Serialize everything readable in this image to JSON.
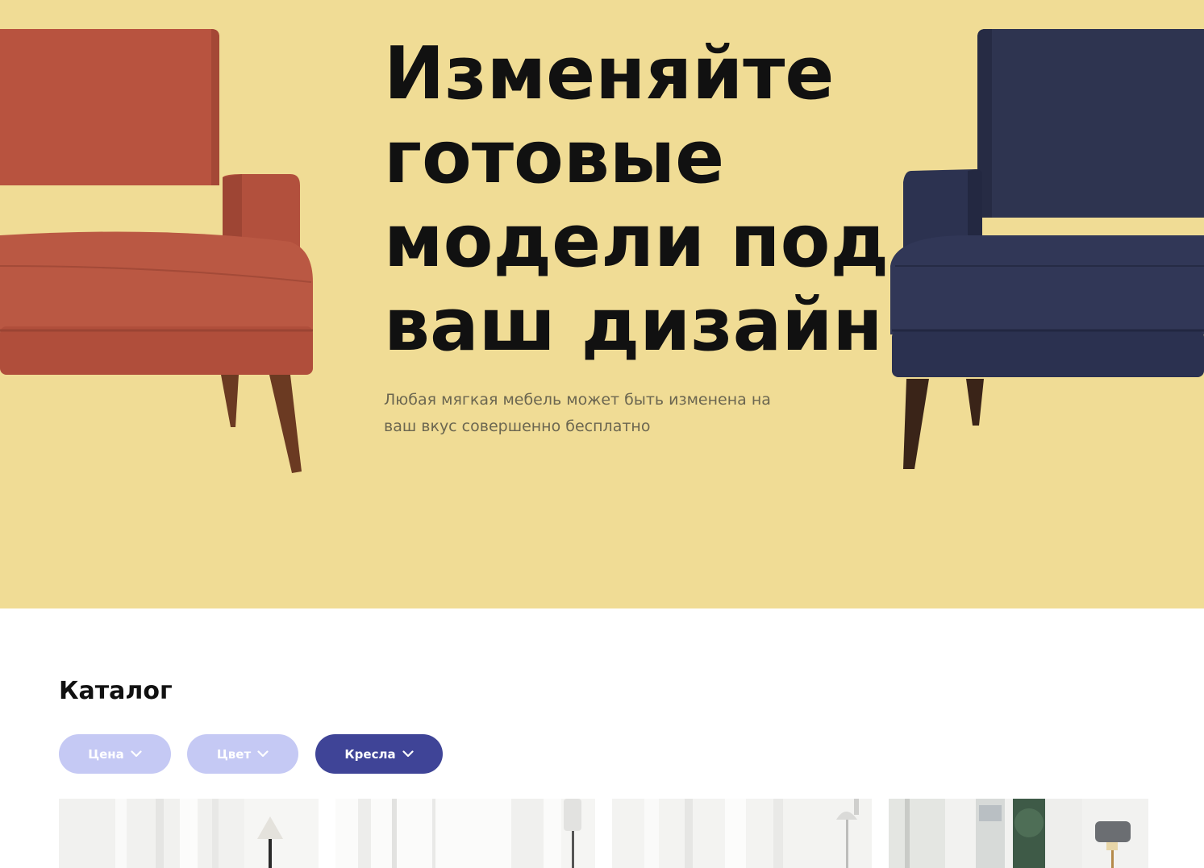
{
  "hero": {
    "title_lines": [
      "Изменяйте",
      "готовые",
      "модели под",
      "ваш дизайн"
    ],
    "subtitle_lines": [
      "Любая мягкая мебель может быть изменена на",
      "ваш вкус совершенно бесплатно"
    ],
    "background_color": "#F0DC95",
    "left_chair_color": "#B8533F",
    "right_chair_color": "#2E3450"
  },
  "catalog": {
    "title": "Каталог",
    "filters": [
      {
        "label": "Цена",
        "active": false,
        "icon": "chevron-down-icon"
      },
      {
        "label": "Цвет",
        "active": false,
        "icon": "chevron-down-icon"
      },
      {
        "label": "Кресла",
        "active": true,
        "icon": "chevron-down-icon"
      }
    ],
    "accent_color": "#3F4497",
    "inactive_color": "#C5C9F4"
  }
}
